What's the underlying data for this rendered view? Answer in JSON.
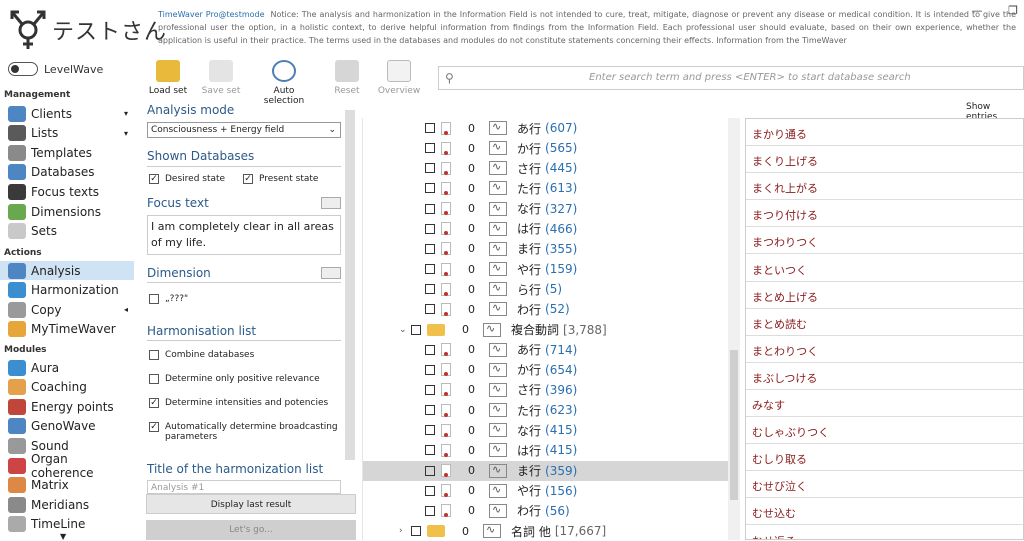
{
  "app": {
    "user_name": "テストさん",
    "product": "TimeWaver Pro@testmode",
    "notice": "Notice: The analysis and harmonization in the Information Field is not intended to cure, treat, mitigate, diagnose or prevent any disease or medical condition. It is intended to give the professional user the option, in a holistic context, to derive helpful information from findings from the Information Field. Each professional user should evaluate, based on their own experience, whether the application is useful in their practice. The terms used in the databases and modules do not constitute statements concerning their effects. Information from the TimeWaver"
  },
  "window": {
    "minimize": "—",
    "restore": "❐"
  },
  "sidebar": {
    "levelwave": "LevelWave",
    "sec_management": "Management",
    "sec_actions": "Actions",
    "sec_modules": "Modules",
    "management": [
      {
        "label": "Clients",
        "arrow": "▾"
      },
      {
        "label": "Lists",
        "arrow": "▾"
      },
      {
        "label": "Templates"
      },
      {
        "label": "Databases"
      },
      {
        "label": "Focus texts"
      },
      {
        "label": "Dimensions"
      },
      {
        "label": "Sets"
      }
    ],
    "actions": [
      {
        "label": "Analysis"
      },
      {
        "label": "Harmonization"
      },
      {
        "label": "Copy",
        "arrow": "◂"
      },
      {
        "label": "MyTimeWaver"
      }
    ],
    "modules": [
      {
        "label": "Aura"
      },
      {
        "label": "Coaching"
      },
      {
        "label": "Energy points"
      },
      {
        "label": "GenoWave"
      },
      {
        "label": "Sound"
      },
      {
        "label": "Organ coherence"
      },
      {
        "label": "Matrix"
      },
      {
        "label": "Meridians"
      },
      {
        "label": "TimeLine"
      }
    ]
  },
  "toolbar": {
    "load_set": "Load set",
    "save_set": "Save set",
    "auto_selection": "Auto selection",
    "reset": "Reset",
    "overview": "Overview"
  },
  "search": {
    "placeholder": "Enter search term and press <ENTER> to start database search"
  },
  "show_entries": "Show entries",
  "panel": {
    "analysis_mode_title": "Analysis mode",
    "analysis_mode_value": "Consciousness + Energy field",
    "shown_db_title": "Shown Databases",
    "desired_state": "Desired state",
    "present_state": "Present state",
    "focus_title": "Focus text",
    "focus_value": "I am completely clear in all areas of my life.",
    "dimension_title": "Dimension",
    "dimension_value": "„???\"",
    "harm_title": "Harmonisation list",
    "combine": "Combine databases",
    "positive": "Determine only positive relevance",
    "intensities": "Determine intensities and potencies",
    "broadcast": "Automatically determine broadcasting parameters",
    "title_harm": "Title of the harmonization list",
    "title_value": "Analysis #1",
    "display_last": "Display last result",
    "lets_go": "Let's go..."
  },
  "tree": [
    {
      "t": "doc",
      "n": "0",
      "l": "あ行",
      "c": "(607)"
    },
    {
      "t": "doc",
      "n": "0",
      "l": "か行",
      "c": "(565)"
    },
    {
      "t": "doc",
      "n": "0",
      "l": "さ行",
      "c": "(445)"
    },
    {
      "t": "doc",
      "n": "0",
      "l": "た行",
      "c": "(613)"
    },
    {
      "t": "doc",
      "n": "0",
      "l": "な行",
      "c": "(327)"
    },
    {
      "t": "doc",
      "n": "0",
      "l": "は行",
      "c": "(466)"
    },
    {
      "t": "doc",
      "n": "0",
      "l": "ま行",
      "c": "(355)"
    },
    {
      "t": "doc",
      "n": "0",
      "l": "や行",
      "c": "(159)"
    },
    {
      "t": "doc",
      "n": "0",
      "l": "ら行",
      "c": "(5)"
    },
    {
      "t": "doc",
      "n": "0",
      "l": "わ行",
      "c": "(52)"
    },
    {
      "t": "folder",
      "tog": "⌄",
      "n": "0",
      "l": "複合動詞",
      "c": "[3,788]"
    },
    {
      "t": "doc",
      "n": "0",
      "l": "あ行",
      "c": "(714)"
    },
    {
      "t": "doc",
      "n": "0",
      "l": "か行",
      "c": "(654)"
    },
    {
      "t": "doc",
      "n": "0",
      "l": "さ行",
      "c": "(396)"
    },
    {
      "t": "doc",
      "n": "0",
      "l": "た行",
      "c": "(623)"
    },
    {
      "t": "doc",
      "n": "0",
      "l": "な行",
      "c": "(415)"
    },
    {
      "t": "doc",
      "n": "0",
      "l": "は行",
      "c": "(415)"
    },
    {
      "t": "doc",
      "n": "0",
      "l": "ま行",
      "c": "(359)",
      "hl": true
    },
    {
      "t": "doc",
      "n": "0",
      "l": "や行",
      "c": "(156)"
    },
    {
      "t": "doc",
      "n": "0",
      "l": "わ行",
      "c": "(56)"
    },
    {
      "t": "folder",
      "tog": "›",
      "n": "0",
      "l": "名詞 他",
      "c": "[17,667]"
    }
  ],
  "entries": [
    "まかり通る",
    "まくり上げる",
    "まくれ上がる",
    "まつり付ける",
    "まつわりつく",
    "まといつく",
    "まとめ上げる",
    "まとめ読む",
    "まとわりつく",
    "まぶしつける",
    "みなす",
    "むしゃぶりつく",
    "むしり取る",
    "むせび泣く",
    "むせ込む",
    "むせ返る"
  ]
}
